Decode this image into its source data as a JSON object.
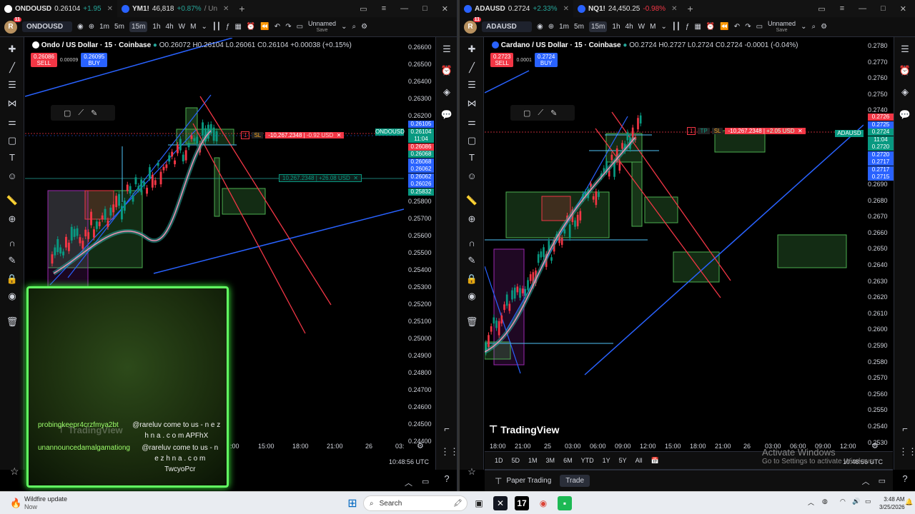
{
  "left_window": {
    "tabs": [
      {
        "symbol": "ONDOUSD",
        "price": "0.26104",
        "change": "+1.95"
      },
      {
        "symbol": "YM1!",
        "price": "46,818",
        "change": "+0.87%",
        "extra": "/ Un"
      }
    ],
    "toolbar": {
      "avatar": "R",
      "badge": "11",
      "symbol": "ONDOUSD",
      "intervals": [
        "1m",
        "5m",
        "15m",
        "1h",
        "4h",
        "W",
        "M"
      ],
      "active_interval": "15m",
      "layout_name": "Unnamed",
      "layout_sub": "Save"
    },
    "legend": {
      "title": "Ondo / US Dollar · 15 · Coinbase",
      "ohlc": "O0.26072 H0.26104 L0.26061 C0.26104 +0.00038 (+0.15%)"
    },
    "sell_price": "0.26086",
    "sell_label": "SELL",
    "spread": "0.00009",
    "buy_price": "0.26095",
    "buy_label": "BUY",
    "price_ticks": [
      "0.26600",
      "0.26500",
      "0.26400",
      "0.26300",
      "0.26200",
      "0.25800",
      "0.25700",
      "0.25600",
      "0.25500",
      "0.25400",
      "0.25300",
      "0.25200",
      "0.25100",
      "0.25000",
      "0.24900",
      "0.24800",
      "0.24700",
      "0.24600",
      "0.24500",
      "0.24400"
    ],
    "price_badges": [
      {
        "text": "0.26105",
        "color": "#2962ff"
      },
      {
        "text": "0.26104",
        "color": "#089981"
      },
      {
        "text": "11:04",
        "color": "#089981"
      },
      {
        "text": "0.26086",
        "color": "#f23645"
      },
      {
        "text": "0.26068",
        "color": "#089981"
      },
      {
        "text": "0.26068",
        "color": "#2962ff"
      },
      {
        "text": "0.26062",
        "color": "#2962ff"
      },
      {
        "text": "0.26062",
        "color": "#2962ff"
      },
      {
        "text": "0.26026",
        "color": "#2962ff"
      },
      {
        "text": "0.25832",
        "color": "#089981"
      }
    ],
    "symbol_badge": "ONDOUSD",
    "position_sl": {
      "qty": "1",
      "label": "SL",
      "pnl": "-10,267.2348",
      "pnl2": "-0.92 USD"
    },
    "position_tp": {
      "pnl": "10,267.2348",
      "pnl2": "+26.08 USD"
    },
    "time_ticks": [
      "15:00",
      "18:00",
      "21:00",
      "26",
      "03:"
    ],
    "partial_tick": ":00",
    "clock": "10:48:56 UTC",
    "chat": [
      {
        "user": "probingkeepr4crzfmya2bt",
        "text": "@rareluv come to us - n e z h n a . c o m APFhX"
      },
      {
        "user": "unannouncedamalgamationg",
        "text": "@rareluv come to us - n e z h n a . c o m TwcyoPcr"
      }
    ],
    "watermark": "TradingView"
  },
  "right_window": {
    "tabs": [
      {
        "symbol": "ADAUSD",
        "price": "0.2724",
        "change": "+2.33%"
      },
      {
        "symbol": "NQ1!",
        "price": "24,450.25",
        "change": "-0.98%"
      }
    ],
    "toolbar": {
      "avatar": "R",
      "badge": "11",
      "symbol": "ADAUSD",
      "intervals": [
        "1m",
        "5m",
        "15m",
        "1h",
        "4h",
        "W",
        "M"
      ],
      "active_interval": "15m",
      "layout_name": "Unnamed",
      "layout_sub": "Save"
    },
    "legend": {
      "title": "Cardano / US Dollar · 15 · Coinbase",
      "ohlc": "O0.2724 H0.2727 L0.2724 C0.2724 -0.0001 (-0.04%)"
    },
    "sell_price": "0.2723",
    "sell_label": "SELL",
    "spread": "0.0001",
    "buy_price": "0.2724",
    "buy_label": "BUY",
    "price_ticks": [
      "0.2780",
      "0.2770",
      "0.2760",
      "0.2750",
      "0.2740",
      "0.2690",
      "0.2680",
      "0.2670",
      "0.2660",
      "0.2650",
      "0.2640",
      "0.2630",
      "0.2620",
      "0.2610",
      "0.2600",
      "0.2590",
      "0.2580",
      "0.2570",
      "0.2560",
      "0.2550",
      "0.2540",
      "0.2530"
    ],
    "price_badges": [
      {
        "text": "0.2726",
        "color": "#f23645"
      },
      {
        "text": "0.2725",
        "color": "#2962ff"
      },
      {
        "text": "0.2724",
        "color": "#089981"
      },
      {
        "text": "11:04",
        "color": "#089981"
      },
      {
        "text": "0.2720",
        "color": "#089981"
      },
      {
        "text": "0.2720",
        "color": "#2962ff"
      },
      {
        "text": "0.2717",
        "color": "#2962ff"
      },
      {
        "text": "0.2717",
        "color": "#2962ff"
      },
      {
        "text": "0.2715",
        "color": "#2962ff"
      }
    ],
    "symbol_badge": "ADAUSD",
    "position": {
      "qty": "1",
      "tp": "TP",
      "sl": "SL",
      "pnl": "-10,267.2348",
      "pnl2": "+2.05 USD"
    },
    "time_ticks": [
      "18:00",
      "21:00",
      "25",
      "03:00",
      "06:00",
      "09:00",
      "12:00",
      "15:00",
      "18:00",
      "21:00",
      "26",
      "03:00",
      "06:00",
      "09:00",
      "12:00"
    ],
    "clock": "10:48:56 UTC",
    "ranges": [
      "1D",
      "5D",
      "1M",
      "3M",
      "6M",
      "YTD",
      "1Y",
      "5Y",
      "All"
    ],
    "paper_trading": "Paper Trading",
    "trade": "Trade",
    "watermark": "TradingView",
    "activate_title": "Activate Windows",
    "activate_sub": "Go to Settings to activate Windows."
  },
  "taskbar": {
    "notification_title": "Wildfire update",
    "notification_sub": "Now",
    "search_placeholder": "Search",
    "time": "3:48 AM",
    "date": "3/25/2026"
  },
  "colors": {
    "up": "#089981",
    "down": "#f23645",
    "accent": "#2962ff",
    "chat_border": "#62ff62"
  }
}
